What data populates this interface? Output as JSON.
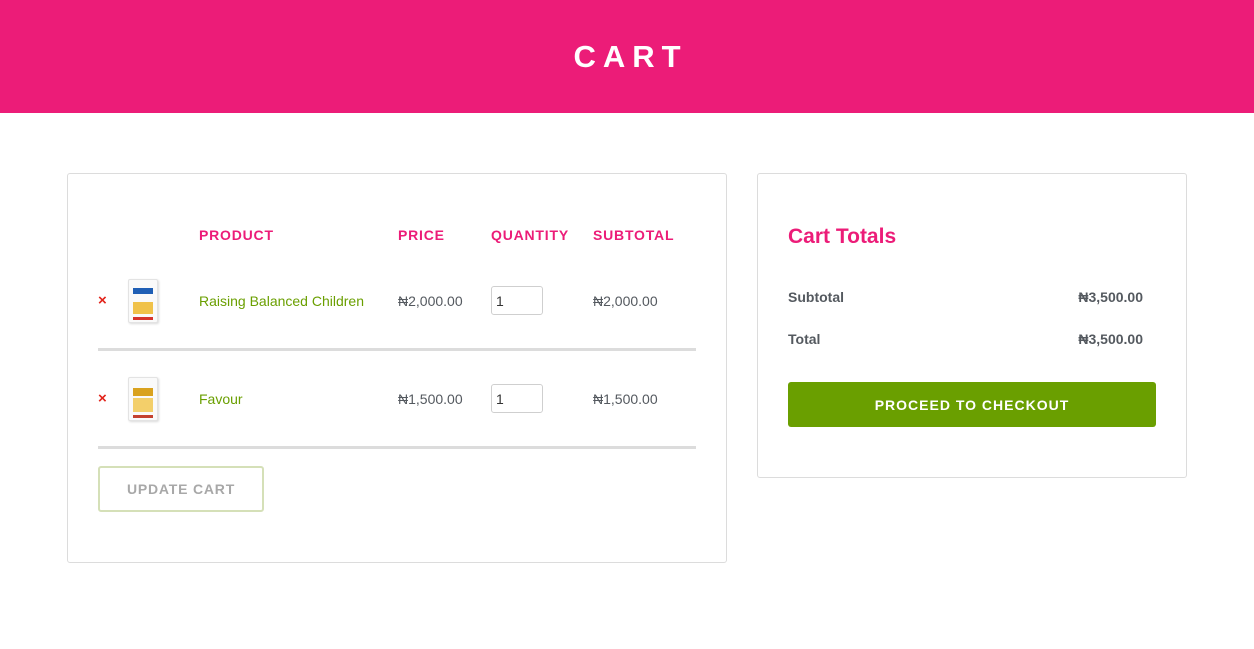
{
  "banner": {
    "title": "CART"
  },
  "cart": {
    "headers": {
      "product": "PRODUCT",
      "price": "PRICE",
      "quantity": "QUANTITY",
      "subtotal": "SUBTOTAL"
    },
    "remove_symbol": "×",
    "items": [
      {
        "name": "Raising Balanced Children",
        "price": "₦2,000.00",
        "quantity": "1",
        "subtotal": "₦2,000.00",
        "thumbnail": "book-cover-raising-balanced-children"
      },
      {
        "name": "Favour",
        "price": "₦1,500.00",
        "quantity": "1",
        "subtotal": "₦1,500.00",
        "thumbnail": "book-cover-favour"
      }
    ],
    "update_label": "UPDATE CART"
  },
  "totals": {
    "title": "Cart Totals",
    "subtotal_label": "Subtotal",
    "subtotal_value": "₦3,500.00",
    "total_label": "Total",
    "total_value": "₦3,500.00",
    "checkout_label": "PROCEED TO CHECKOUT"
  },
  "colors": {
    "brand_pink": "#ec1c78",
    "accent_green": "#6a9f00",
    "remove_red": "#e2231a",
    "text_gray": "#54595f",
    "border_gray": "#dcdcdc"
  }
}
